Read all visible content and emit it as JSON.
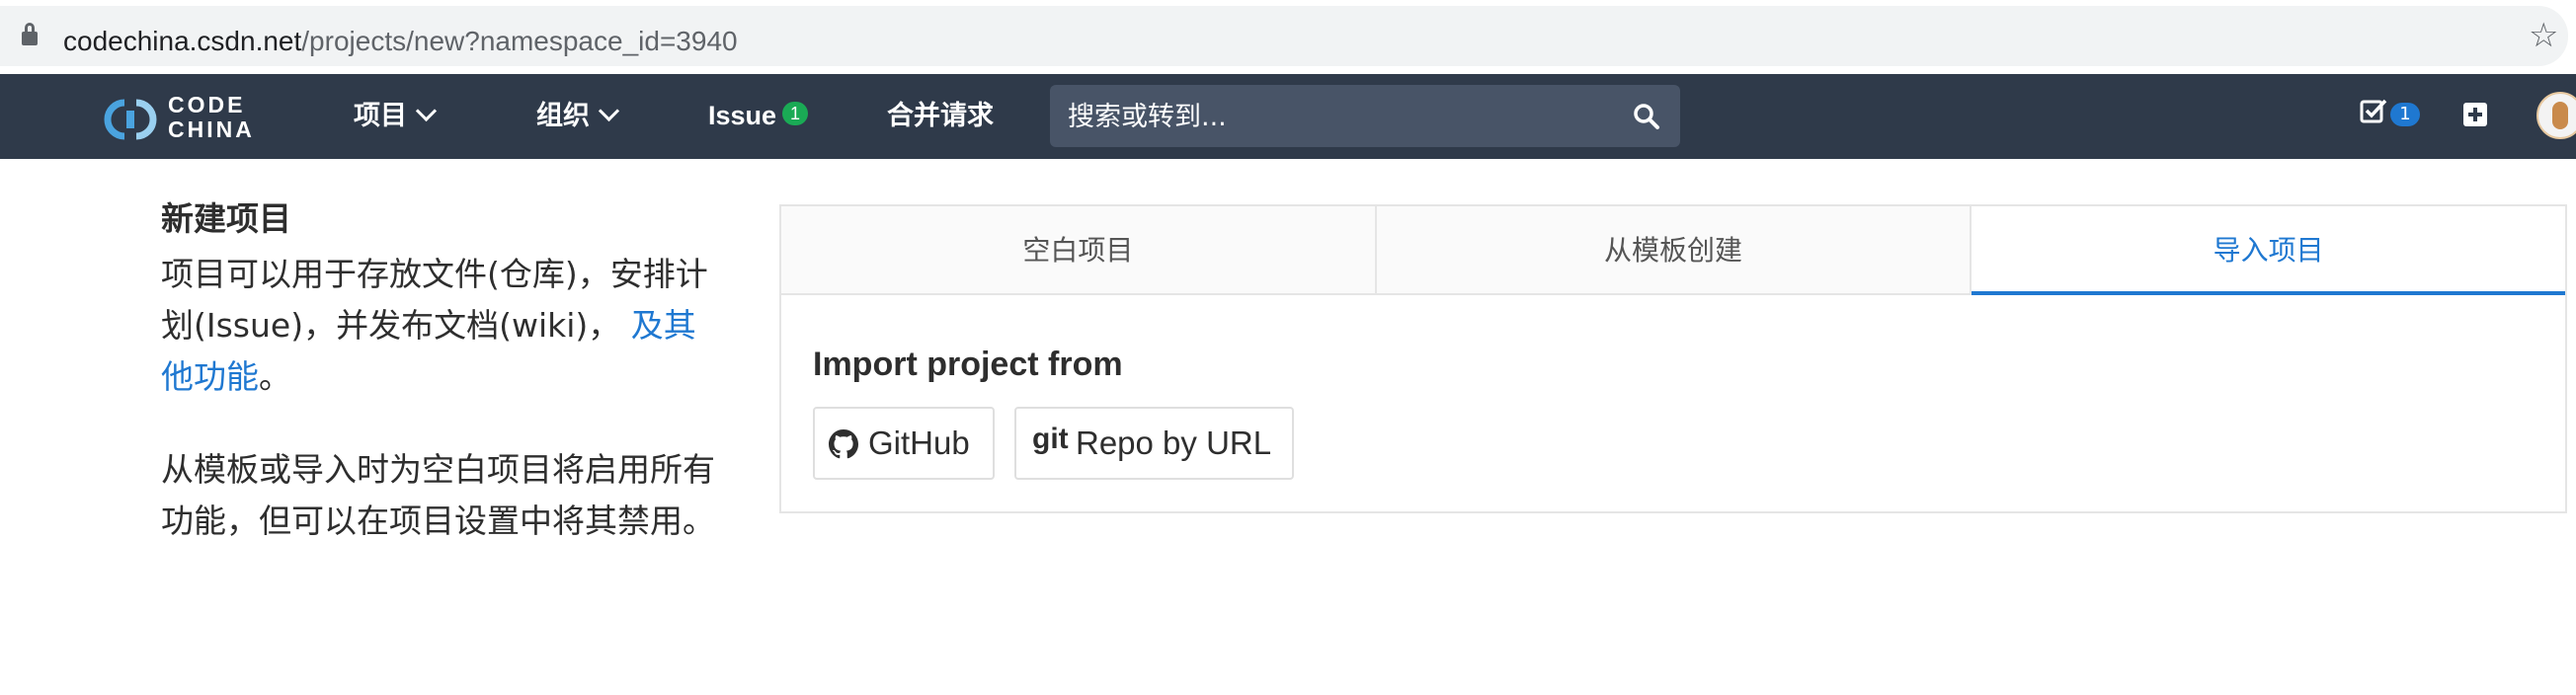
{
  "browser": {
    "url_host": "codechina.csdn.net",
    "url_path": "/projects/new?namespace_id=3940"
  },
  "navbar": {
    "logo_line1": "CODE",
    "logo_line2": "CHINA",
    "items": [
      {
        "label": "项目"
      },
      {
        "label": "组织"
      },
      {
        "label": "Issue",
        "badge": "1"
      },
      {
        "label": "合并请求"
      }
    ],
    "search_placeholder": "搜索或转到...",
    "todo_badge": "1"
  },
  "sidebar": {
    "title": "新建项目",
    "desc_text": "项目可以用于存放文件(仓库)，安排计划(Issue)，并发布文档(wiki)，",
    "desc_link": "及其他功能",
    "desc_end": "。",
    "note": "从模板或导入时为空白项目将启用所有功能，但可以在项目设置中将其禁用。"
  },
  "tabs": [
    {
      "label": "空白项目",
      "active": false
    },
    {
      "label": "从模板创建",
      "active": false
    },
    {
      "label": "导入项目",
      "active": true
    }
  ],
  "import": {
    "title": "Import project from",
    "buttons": [
      {
        "label": "GitHub",
        "icon": "github-icon"
      },
      {
        "label": "Repo by URL",
        "icon": "git-icon",
        "prefix": "git"
      }
    ]
  },
  "colors": {
    "navbar": "#2f3a4a",
    "accent": "#1f78d1",
    "badge_green": "#1aaa55"
  }
}
